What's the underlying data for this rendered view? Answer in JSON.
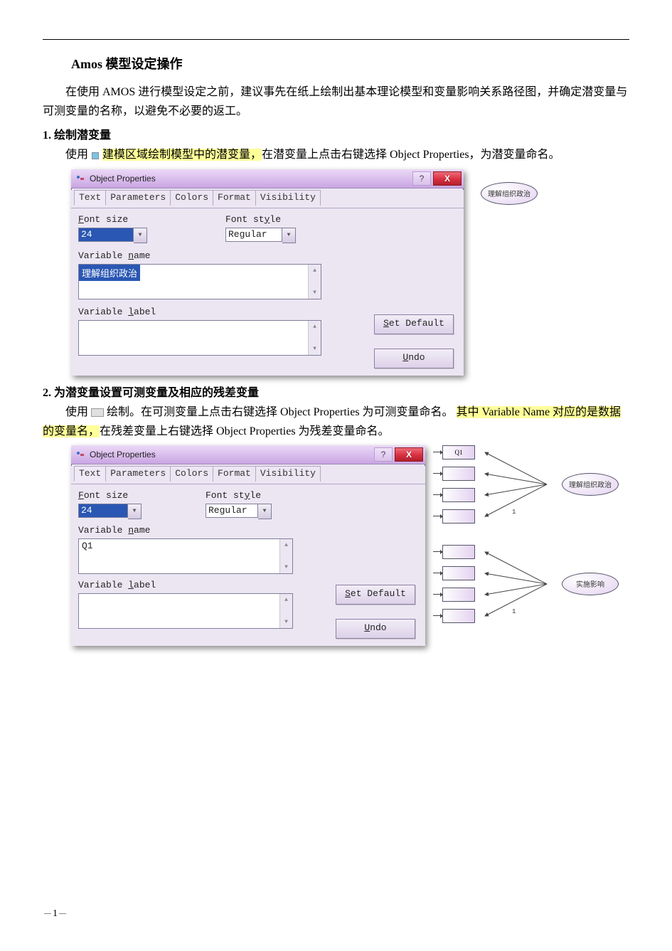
{
  "doc": {
    "title": "Amos 模型设定操作",
    "intro": "在使用 AMOS 进行模型设定之前，建议事先在纸上绘制出基本理论模型和变量影响关系路径图，并确定潜变量与可测变量的名称，以避免不必要的返工。",
    "section1": {
      "heading": "1. 绘制潜变量",
      "text_before_hl": "使用",
      "hl1": "建模区域绘制模型中的潜变量，",
      "text_mid": "在潜变量上点击右键选择 Object Properties，为潜变量命名。"
    },
    "section2": {
      "heading": "2. 为潜变量设置可测变量及相应的残差变量",
      "para_parts": {
        "a": "使用",
        "b": "绘制。在可测变量上点击右键选择 Object Properties 为可测变量命名。",
        "hl_c": "其中 Variable Name 对应的是数据的变量名，",
        "d": "在残差变量上右键选择 Object Properties 为残差变量命名。"
      }
    },
    "page_number": "1"
  },
  "dialog1": {
    "title": "Object Properties",
    "tabs": [
      "Text",
      "Parameters",
      "Colors",
      "Format",
      "Visibility"
    ],
    "labels": {
      "font_size": "Font size",
      "font_style": "Font style",
      "variable_name": "Variable name",
      "variable_label": "Variable label"
    },
    "values": {
      "font_size": "24",
      "font_style": "Regular",
      "variable_name": "理解组织政治",
      "variable_label": ""
    },
    "buttons": {
      "set_default": "Set Default",
      "undo": "Undo"
    },
    "titlebar_help": "?",
    "titlebar_close": "X"
  },
  "dialog2": {
    "title": "Object Properties",
    "tabs": [
      "Text",
      "Parameters",
      "Colors",
      "Format",
      "Visibility"
    ],
    "labels": {
      "font_size": "Font size",
      "font_style": "Font style",
      "variable_name": "Variable name",
      "variable_label": "Variable label"
    },
    "values": {
      "font_size": "24",
      "font_style": "Regular",
      "variable_name": "Q1",
      "variable_label": ""
    },
    "buttons": {
      "set_default": "Set Default",
      "undo": "Undo"
    },
    "titlebar_help": "?",
    "titlebar_close": "X"
  },
  "side1": {
    "latent_name": "理解组织政治"
  },
  "side2": {
    "block1": {
      "latent_name": "理解组织政治",
      "observed": [
        "Q1",
        "",
        "",
        ""
      ],
      "coef": "1"
    },
    "block2": {
      "latent_name": "实施影响",
      "observed": [
        "",
        "",
        "",
        ""
      ],
      "coef": "1"
    }
  }
}
